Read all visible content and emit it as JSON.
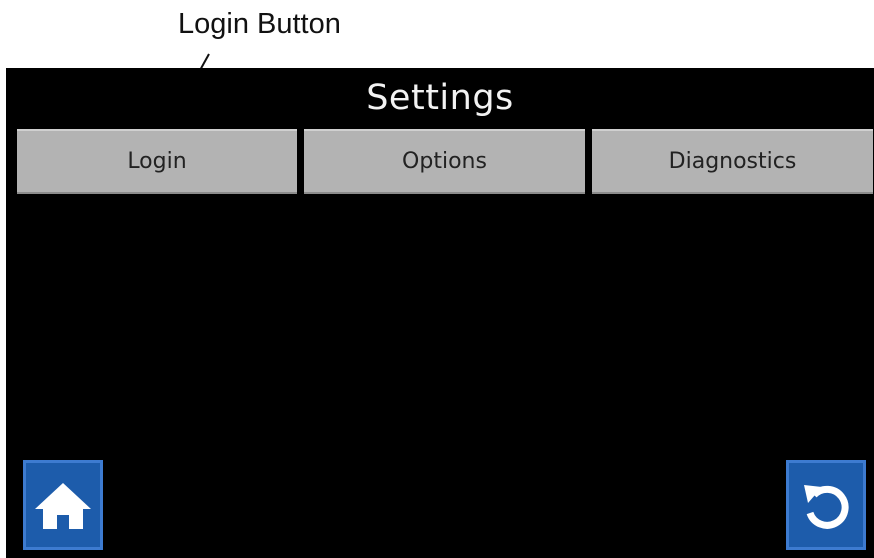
{
  "annotation": {
    "callout_label": "Login Button"
  },
  "screen": {
    "title": "Settings",
    "tabs": [
      {
        "label": "Login"
      },
      {
        "label": "Options"
      },
      {
        "label": "Diagnostics"
      }
    ],
    "home_icon": "home-icon",
    "back_icon": "undo-arrow-icon"
  },
  "colors": {
    "screen_background": "#000000",
    "tab_background": "#b3b3b3",
    "icon_button_background": "#1d5cab",
    "icon_foreground": "#ffffff"
  }
}
